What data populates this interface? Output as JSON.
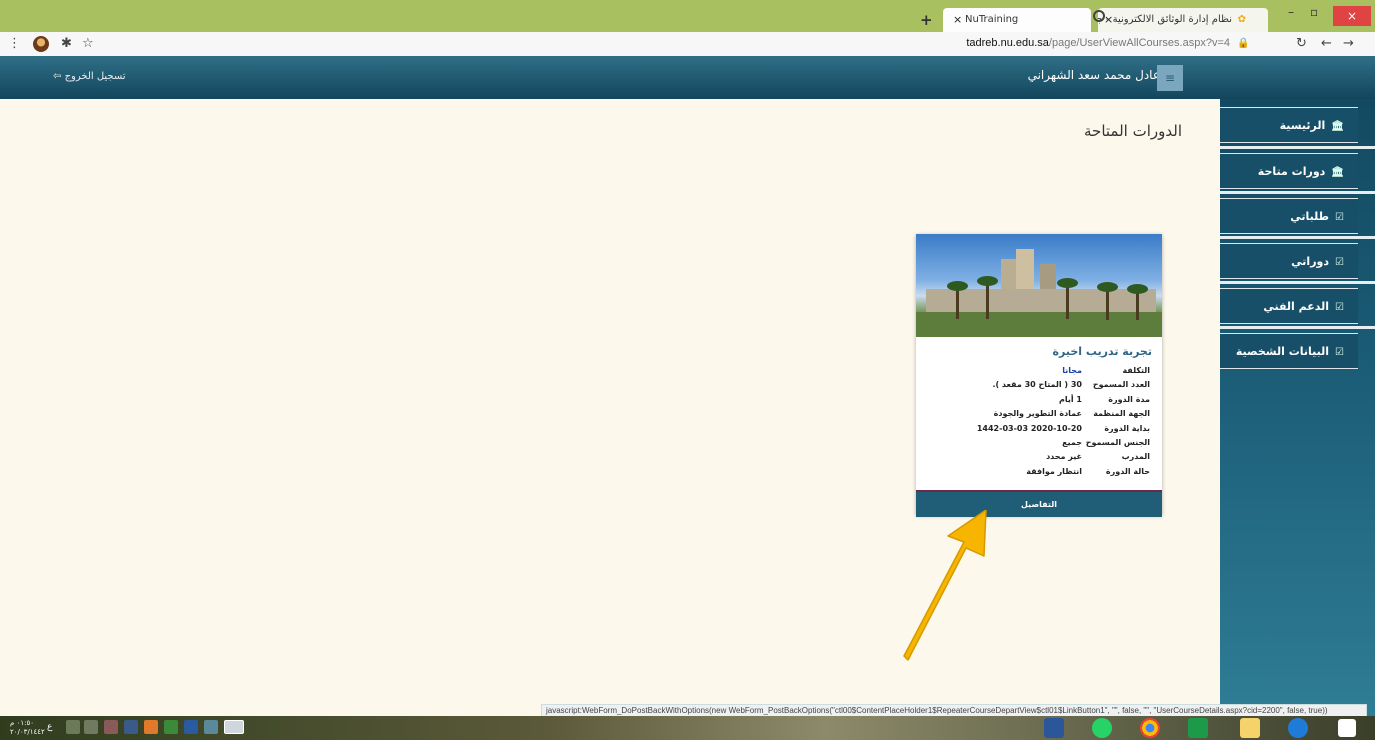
{
  "browser": {
    "tabs": [
      {
        "label": "NuTraining",
        "active": true
      },
      {
        "label": "نظام إدارة الوثائق الالكترونية - جامعة",
        "active": false
      }
    ],
    "new_tab": "+",
    "close_glyph": "×",
    "window_controls": {
      "minimize": "–",
      "maximize": "▫",
      "close": "×"
    },
    "address": {
      "host": "tadreb.nu.edu.sa",
      "path": "/page/UserViewAllCourses.aspx?v=4"
    },
    "status_text": "javascript:WebForm_DoPostBackWithOptions(new WebForm_PostBackOptions(\"ctl00$ContentPlaceHolder1$RepeaterCourseDepartView$ctl01$LinkButton1\", \"\", false, \"\", \"UserCourseDetails.aspx?cid=2200\", false, true))"
  },
  "header": {
    "logout_label": "تسجيل الخروج",
    "user_name": "عادل محمد سعد الشهراني",
    "menu_icon": "≡"
  },
  "sidebar": {
    "items": [
      {
        "label": "الرئيسية",
        "icon": "bank-icon"
      },
      {
        "label": "دورات متاحة",
        "icon": "bank-icon"
      },
      {
        "label": "طلباتي",
        "icon": "list-icon"
      },
      {
        "label": "دوراتي",
        "icon": "list-icon"
      },
      {
        "label": "الدعم الفني",
        "icon": "list-icon"
      },
      {
        "label": "البيانات الشخصية",
        "icon": "list-icon"
      }
    ]
  },
  "main": {
    "page_title": "الدورات المتاحة",
    "course_card": {
      "title": "تجربة تدريب اخيرة",
      "rows": [
        {
          "label": "التكلفة",
          "value": "مجانا"
        },
        {
          "label": "العدد المسموح",
          "value": "30 ( المتاح 30 مقعد )."
        },
        {
          "label": "مدة الدورة",
          "value": "1 أيام"
        },
        {
          "label": "الجهة المنظمة",
          "value": "عمادة التطوير والجودة"
        },
        {
          "label": "بداية الدورة",
          "value": "2020-10-20  1442-03-03"
        },
        {
          "label": "الجنس المسموح",
          "value": "جميع"
        },
        {
          "label": "المدرب",
          "value": "غير محدد"
        },
        {
          "label": "حالة الدورة",
          "value": "انتظار موافقة"
        }
      ],
      "details_button": "التفاصيل"
    }
  },
  "taskbar": {
    "time": "٠١:٥٠ م",
    "date": "٢٠/٠٣/١٤٤٢",
    "lang": "ع"
  },
  "colors": {
    "header_bg": "#1e5a73",
    "sidebar_bg": "#174f68",
    "page_bg": "#fdf8ec",
    "arrow": "#f7b500"
  }
}
